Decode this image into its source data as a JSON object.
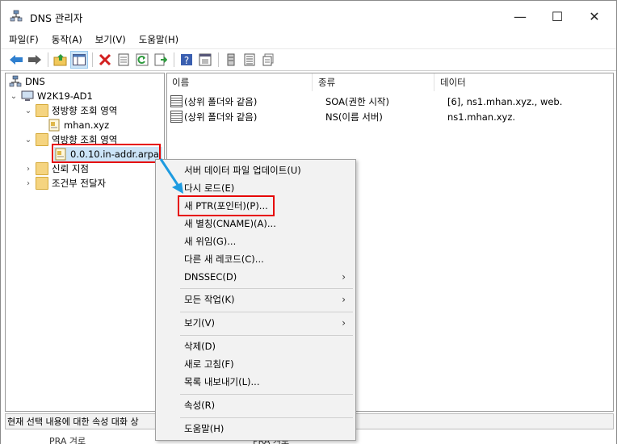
{
  "window": {
    "title": "DNS 관리자",
    "minimize_glyph": "—",
    "maximize_glyph": "☐",
    "close_glyph": "✕"
  },
  "menubar": [
    "파일(F)",
    "동작(A)",
    "보기(V)",
    "도움말(H)"
  ],
  "toolbar": {
    "icons": [
      "back-icon",
      "forward-icon",
      "up-folder-icon",
      "show-hide-tree-icon",
      "delete-icon",
      "properties-icon",
      "refresh-icon",
      "export-list-icon",
      "help-icon",
      "console-icon",
      "server-icon",
      "list-icon",
      "records-icon"
    ]
  },
  "tree": {
    "root": "DNS",
    "server": "W2K19-AD1",
    "forward_zones": "정방향 조회 영역",
    "forward_zone_item": "mhan.xyz",
    "reverse_zones": "역방향 조회 영역",
    "reverse_zone_item": "0.0.10.in-addr.arpa",
    "trust_points": "신뢰 지점",
    "conditional_forwarders": "조건부 전달자"
  },
  "list": {
    "columns": [
      "이름",
      "종류",
      "데이터"
    ],
    "rows": [
      {
        "name": "(상위 폴더와 같음)",
        "type": "SOA(권한 시작)",
        "data": "[6], ns1.mhan.xyz., web."
      },
      {
        "name": "(상위 폴더와 같음)",
        "type": "NS(이름 서버)",
        "data": "ns1.mhan.xyz."
      }
    ]
  },
  "context_menu": {
    "items": [
      {
        "label": "서버 데이터 파일 업데이트(U)"
      },
      {
        "label": "다시 로드(E)"
      },
      {
        "label": "새 PTR(포인터)(P)..."
      },
      {
        "label": "새 별칭(CNAME)(A)..."
      },
      {
        "label": "새 위임(G)..."
      },
      {
        "label": "다른 새 레코드(C)..."
      },
      {
        "label": "DNSSEC(D)"
      },
      {
        "label": "모든 작업(K)"
      },
      {
        "label": "보기(V)"
      },
      {
        "label": "삭제(D)"
      },
      {
        "label": "새로 고침(F)"
      },
      {
        "label": "목록 내보내기(L)..."
      },
      {
        "label": "속성(R)"
      },
      {
        "label": "도움말(H)"
      }
    ],
    "submenu_arrow": "›"
  },
  "statusbar": {
    "text": "현재 선택 내용에 대한 속성 대화 상"
  },
  "bottom_strip": {
    "frag1": "PRA 겨로",
    "frag2": "PRA 겨로"
  },
  "colors": {
    "highlight_box": "#e60000",
    "arrow": "#1e9be0"
  }
}
